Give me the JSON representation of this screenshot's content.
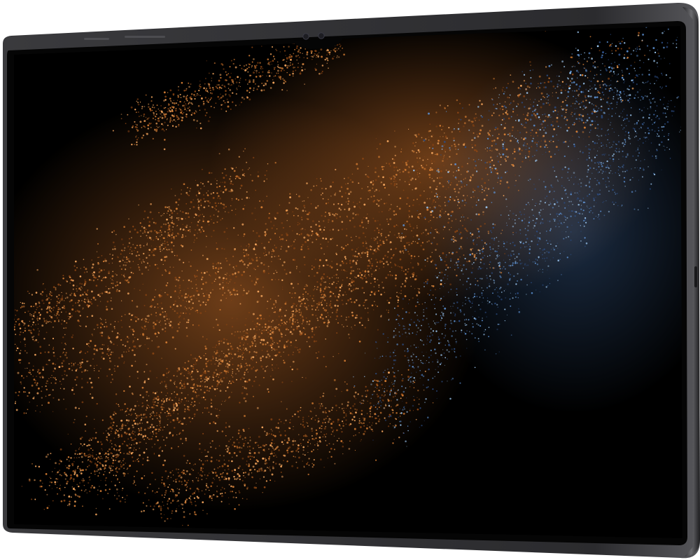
{
  "device": {
    "body_color": "#2a2a2d",
    "frame_edge_color": "#4a4a4e",
    "bezel_color": "#050505",
    "screen_color": "#000000",
    "camera_count": 2,
    "side_buttons": 3
  },
  "wallpaper": {
    "style": "particle-waves",
    "palette": {
      "copper_light": "#f0a35c",
      "copper": "#d07a32",
      "copper_dark": "#8a4514",
      "blue_light": "#9cc8f2",
      "blue": "#5b8fd0",
      "blue_dark": "#2c4e86"
    }
  }
}
